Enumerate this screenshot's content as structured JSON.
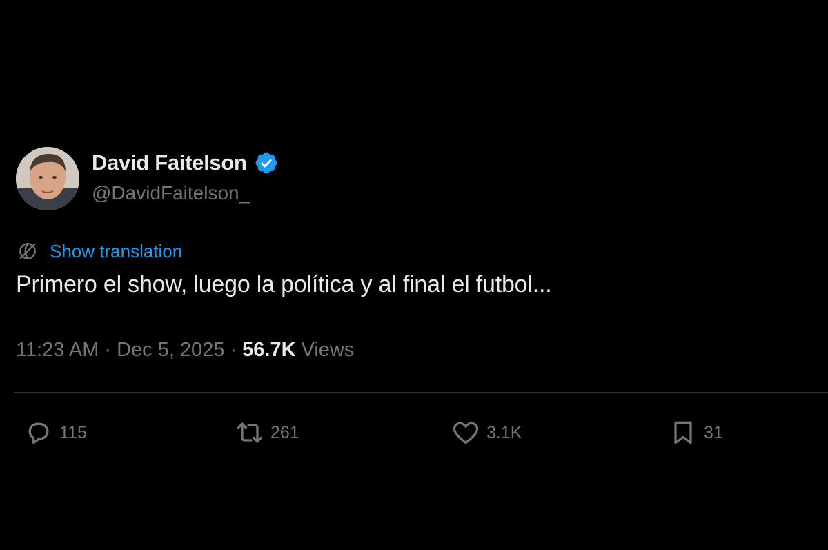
{
  "author": {
    "name": "David Faitelson",
    "handle": "@DavidFaitelson_",
    "verified": true
  },
  "translate": {
    "label": "Show translation"
  },
  "tweet": {
    "text": "Primero el show, luego la política y al final el futbol..."
  },
  "meta": {
    "time": "11:23 AM",
    "separator": "·",
    "date": "Dec 5, 2025",
    "views_count": "56.7K",
    "views_label": "Views"
  },
  "actions": {
    "replies": "115",
    "retweets": "261",
    "likes": "3.1K",
    "bookmarks": "31"
  },
  "colors": {
    "background": "#000000",
    "primary_text": "#e7e9ea",
    "secondary_text": "#71767b",
    "accent": "#1d9bf0",
    "divider": "#2f3336"
  },
  "icons": {
    "verified": "verified-badge-icon",
    "translate": "globe-translate-icon",
    "reply": "comment-icon",
    "retweet": "retweet-icon",
    "like": "heart-icon",
    "bookmark": "bookmark-icon"
  }
}
